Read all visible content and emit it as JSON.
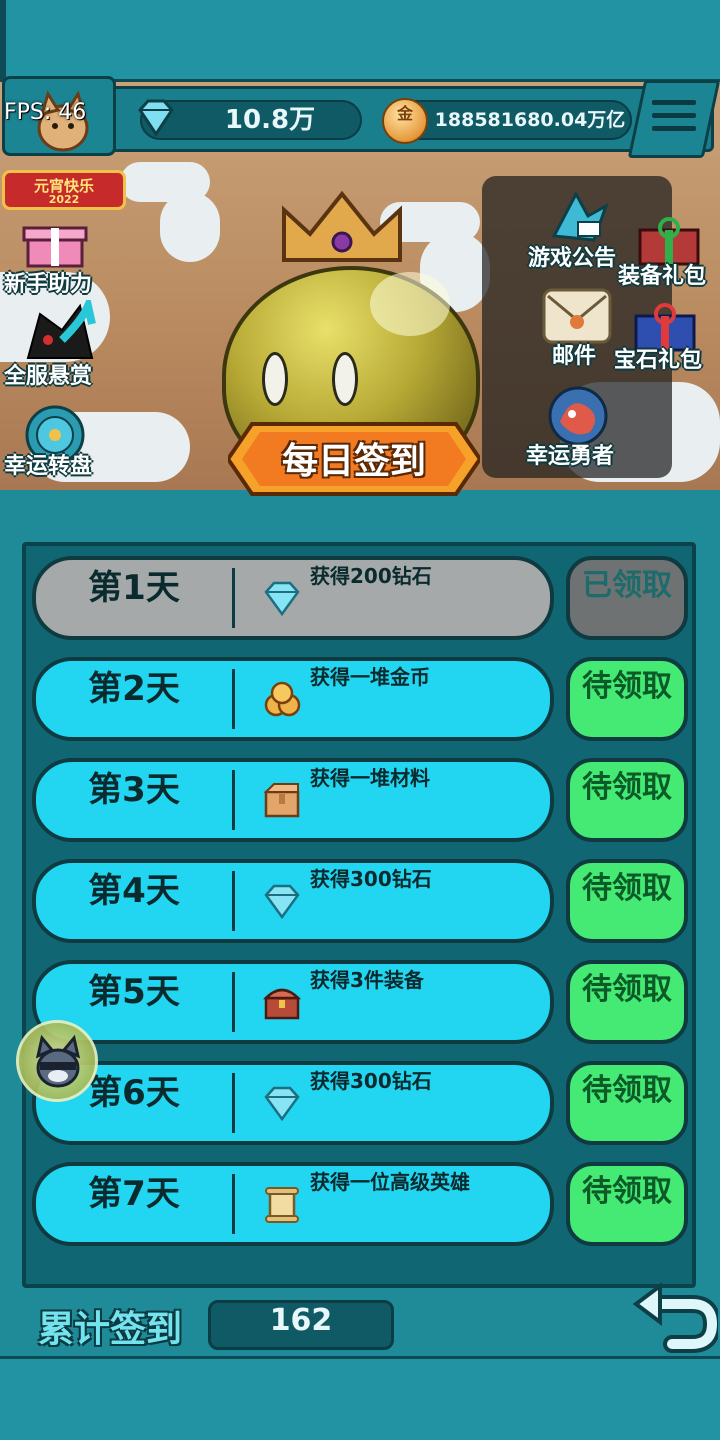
{
  "hud": {
    "fps_label": "FPS: 46",
    "gems": "10.8万",
    "coins": "188581680.04万亿",
    "coin_glyph": "金",
    "festival_text": "元宵快乐",
    "festival_year": "2022"
  },
  "left_menu": [
    {
      "label": "新手助力",
      "icon": "gift-icon"
    },
    {
      "label": "全服悬赏",
      "icon": "bounty-icon"
    },
    {
      "label": "幸运转盘",
      "icon": "wheel-icon"
    }
  ],
  "right_menu": [
    {
      "label": "游戏公告",
      "icon": "announcement-icon"
    },
    {
      "label": "装备礼包",
      "icon": "equipment-gift-icon"
    },
    {
      "label": "邮件",
      "icon": "mail-icon"
    },
    {
      "label": "宝石礼包",
      "icon": "gem-gift-icon"
    },
    {
      "label": "幸运勇者",
      "icon": "lucky-hero-icon"
    }
  ],
  "title": "每日签到",
  "days": [
    {
      "day": "第1天",
      "reward": "获得200钻石",
      "icon": "diamond-icon",
      "status": "已领取",
      "claimed": true
    },
    {
      "day": "第2天",
      "reward": "获得一堆金币",
      "icon": "coins-icon",
      "status": "待领取",
      "claimed": false
    },
    {
      "day": "第3天",
      "reward": "获得一堆材料",
      "icon": "materials-box-icon",
      "status": "待领取",
      "claimed": false
    },
    {
      "day": "第4天",
      "reward": "获得300钻石",
      "icon": "diamond-icon",
      "status": "待领取",
      "claimed": false
    },
    {
      "day": "第5天",
      "reward": "获得3件装备",
      "icon": "treasure-chest-icon",
      "status": "待领取",
      "claimed": false
    },
    {
      "day": "第6天",
      "reward": "获得300钻石",
      "icon": "diamond-icon",
      "status": "待领取",
      "claimed": false
    },
    {
      "day": "第7天",
      "reward": "获得一位高级英雄",
      "icon": "scroll-icon",
      "status": "待领取",
      "claimed": false
    }
  ],
  "footer": {
    "total_label": "累计签到",
    "total_value": "162"
  },
  "colors": {
    "claimed_row": "#a5a9aa",
    "pending_row": "#22d5f0",
    "claim_button": "#45ea74",
    "claimed_button": "#6e7273"
  }
}
